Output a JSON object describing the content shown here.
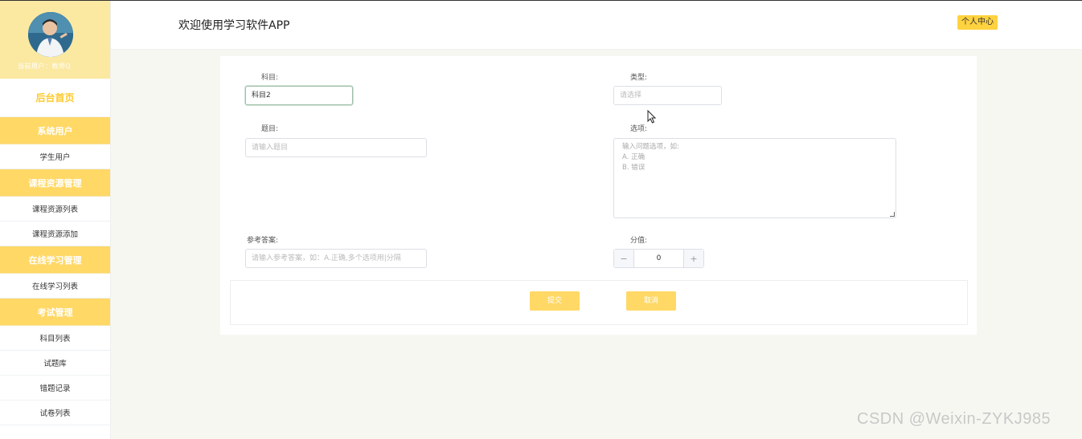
{
  "sidebar": {
    "user_line": "当前用户：教师Q",
    "home": "后台首页",
    "groups": [
      {
        "title": "系统用户",
        "items": [
          "学生用户"
        ]
      },
      {
        "title": "课程资源管理",
        "items": [
          "课程资源列表",
          "课程资源添加"
        ]
      },
      {
        "title": "在线学习管理",
        "items": [
          "在线学习列表"
        ]
      },
      {
        "title": "考试管理",
        "items": [
          "科目列表",
          "试题库",
          "错题记录",
          "试卷列表"
        ]
      }
    ]
  },
  "header": {
    "title": "欢迎使用学习软件APP",
    "user_center": "个人中心"
  },
  "form": {
    "subject_label": "科目:",
    "subject_value": "科目2",
    "type_label": "类型:",
    "type_placeholder": "请选择",
    "question_label": "题目:",
    "question_placeholder": "请输入题目",
    "options_label": "选项:",
    "options_placeholder_lines": [
      "输入问题选项，如:",
      "A. 正确",
      "B. 错误"
    ],
    "answer_label": "参考答案:",
    "answer_placeholder": "请输入参考答案，如：A.正确,多个选项用|分隔",
    "score_label": "分值:",
    "score_value": "0",
    "minus": "−",
    "plus": "+",
    "submit": "提交",
    "cancel": "取消"
  },
  "watermark": "CSDN @Weixin-ZYKJ985",
  "colors": {
    "accent": "#ffd866",
    "profile_bg": "#fbe9a2",
    "header_badge": "#ffd23f"
  }
}
